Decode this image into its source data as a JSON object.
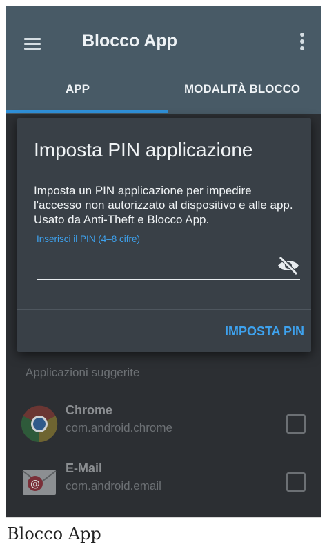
{
  "app": {
    "title": "Blocco App"
  },
  "tabs": [
    {
      "label": "APP",
      "selected": true
    },
    {
      "label": "MODALITÀ BLOCCO",
      "selected": false
    }
  ],
  "dialog": {
    "title": "Imposta PIN applicazione",
    "message": "Imposta un PIN applicazione per impedire l'accesso non autorizzato al dispositivo e alle app. Usato da Anti-Theft e Blocco App.",
    "pin_hint": "Inserisci il PIN (4–8 cifre)",
    "pin_value": "",
    "button_label": "IMPOSTA PIN"
  },
  "list": {
    "section_title": "Applicazioni suggerite",
    "items": [
      {
        "name": "Chrome",
        "package": "com.android.chrome",
        "icon": "chrome-icon",
        "checked": false
      },
      {
        "name": "E-Mail",
        "package": "com.android.email",
        "icon": "email-icon",
        "checked": false
      }
    ]
  },
  "caption": "Blocco App",
  "colors": {
    "accent": "#3ea2ee",
    "appbar": "#485a66",
    "dialog_bg": "#394047"
  }
}
